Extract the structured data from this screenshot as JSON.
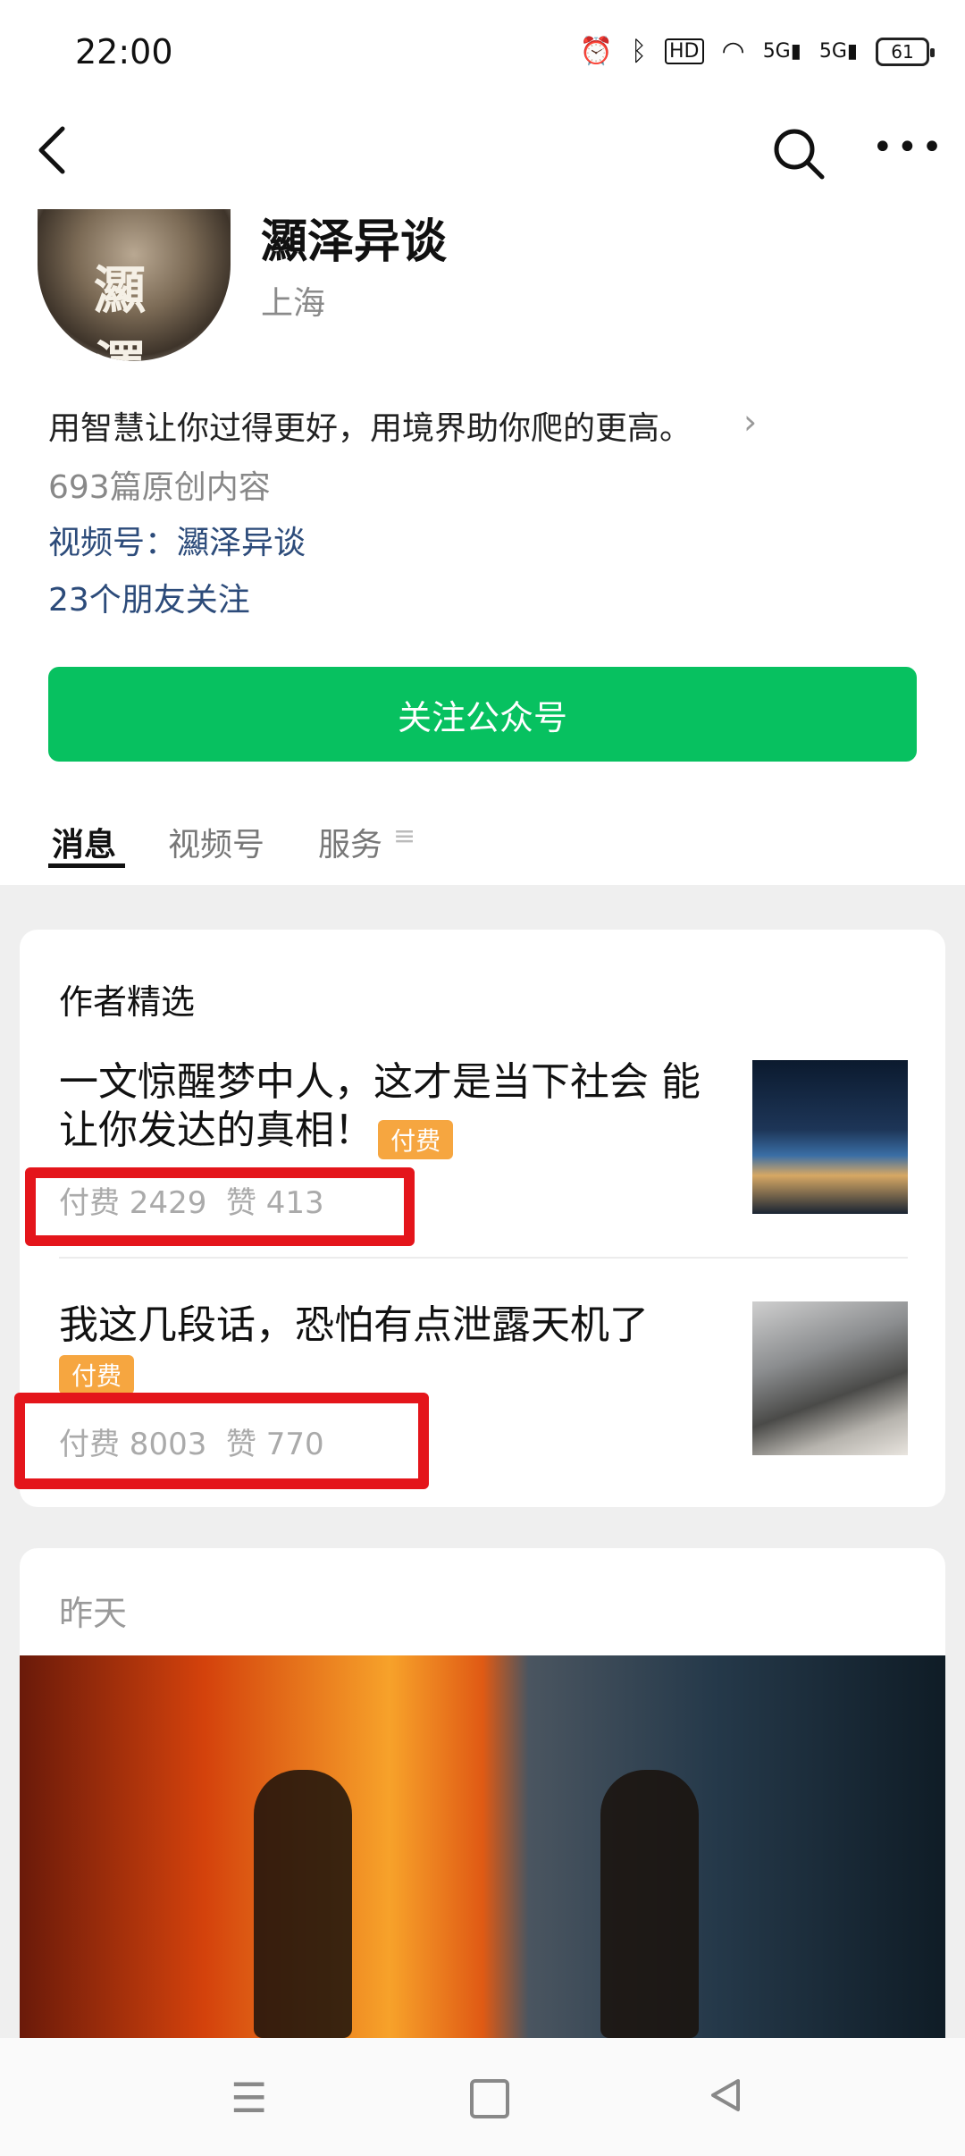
{
  "status_bar": {
    "time": "22:00",
    "battery": "61"
  },
  "profile": {
    "avatar_text": "灦 澤",
    "name": "灦泽异谈",
    "location": "上海",
    "description": "用智慧让你过得更好，用境界助你爬的更高。",
    "original_count": "693篇原创内容",
    "video_account": "视频号：灦泽异谈",
    "friends_follow": "23个朋友关注",
    "follow_button": "关注公众号"
  },
  "tabs": [
    {
      "label": "消息",
      "active": true
    },
    {
      "label": "视频号",
      "active": false
    },
    {
      "label": "服务",
      "active": false
    }
  ],
  "selection": {
    "title": "作者精选",
    "articles": [
      {
        "title": "一文惊醒梦中人，这才是当下社会 能让你发达的真相！",
        "tag": "付费",
        "paid": "付费 2429",
        "likes": "赞 413"
      },
      {
        "title": "我这几段话，恐怕有点泄露天机了",
        "tag": "付费",
        "paid": "付费 8003",
        "likes": "赞 770"
      }
    ]
  },
  "feed": {
    "date_label": "昨天"
  },
  "colors": {
    "accent": "#07c160",
    "link": "#2c4b7a",
    "tag": "#f6a640",
    "highlight": "#e4151b"
  }
}
